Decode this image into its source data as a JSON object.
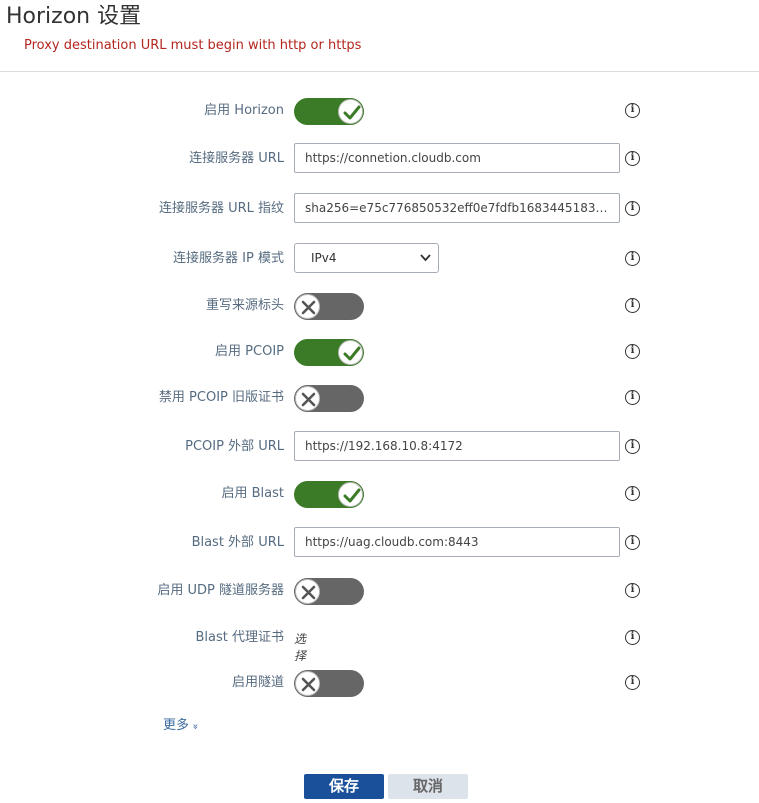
{
  "header": {
    "title": "Horizon 设置",
    "error": "Proxy destination URL must begin with http or https"
  },
  "rows": {
    "enable_horizon": {
      "label": "启用 Horizon",
      "toggle": "on"
    },
    "conn_server_url": {
      "label": "连接服务器 URL",
      "value": "https://connetion.cloudb.com"
    },
    "conn_server_thumbprint": {
      "label": "连接服务器 URL 指纹",
      "value": "sha256=e75c776850532eff0e7fdfb1683445183a..."
    },
    "conn_server_ip_mode": {
      "label": "连接服务器 IP 模式",
      "selected": "IPv4"
    },
    "rewrite_origin_header": {
      "label": "重写来源标头",
      "toggle": "off"
    },
    "enable_pcoip": {
      "label": "启用 PCOIP",
      "toggle": "on"
    },
    "disable_pcoip_legacy_cert": {
      "label": "禁用 PCOIP 旧版证书",
      "toggle": "off"
    },
    "pcoip_external_url": {
      "label": "PCOIP 外部 URL",
      "value": "https://192.168.10.8:4172"
    },
    "enable_blast": {
      "label": "启用 Blast",
      "toggle": "on"
    },
    "blast_external_url": {
      "label": "Blast 外部 URL",
      "value": "https://uag.cloudb.com:8443"
    },
    "enable_udp_tunnel": {
      "label": "启用 UDP 隧道服务器",
      "toggle": "off"
    },
    "blast_proxy_cert": {
      "label": "Blast 代理证书",
      "link": "选择"
    },
    "enable_tunnel": {
      "label": "启用隧道",
      "toggle": "off"
    }
  },
  "info_glyph": "i",
  "more": {
    "label": "更多",
    "icon": "»"
  },
  "buttons": {
    "save": "保存",
    "cancel": "取消"
  },
  "colors": {
    "toggle_on": "#3b7a26",
    "toggle_off": "#666666",
    "primary": "#1a4f9a",
    "error": "#b3261e"
  }
}
